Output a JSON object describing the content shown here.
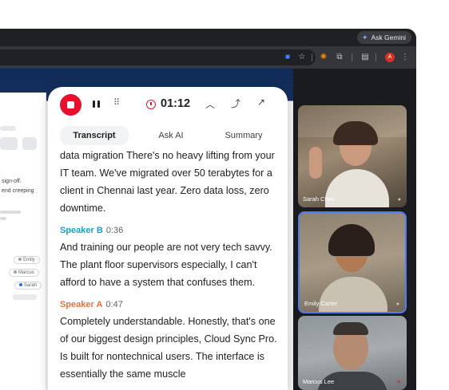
{
  "browser": {
    "gemini_button": "Ask Gemini",
    "profile_initial": "A"
  },
  "document": {
    "lines": [
      "sign-off.",
      "end creeping"
    ],
    "chips": [
      {
        "label": "Emily",
        "color": "#9aa0a6"
      },
      {
        "label": "Marcus",
        "color": "#9aa0a6"
      },
      {
        "label": "Sarah",
        "color": "#1a73e8"
      }
    ]
  },
  "panel": {
    "timer": "01:12",
    "tabs": [
      {
        "label": "Transcript",
        "active": true
      },
      {
        "label": "Ask AI",
        "active": false
      },
      {
        "label": "Summary",
        "active": false
      }
    ],
    "segments": [
      {
        "speaker": "",
        "time": "",
        "text": "data migration There's no heavy lifting from your IT team. We've migrated over 50 terabytes for a client in Chennai last year. Zero data loss, zero downtime."
      },
      {
        "speaker": "Speaker B",
        "time": "0:36",
        "text": "And training our people are not very tech savvy. The plant floor supervisors especially, I can't afford to have a system that confuses them."
      },
      {
        "speaker": "Speaker A",
        "time": "0:47",
        "text": "Completely understandable. Honestly, that's one of our biggest design principles, Cloud Sync Pro. Is built for nontechnical users. The interface is essentially the same muscle"
      }
    ]
  },
  "participants": [
    {
      "name": "Sarah Chen",
      "speaking": false
    },
    {
      "name": "Emily Carter",
      "speaking": true
    },
    {
      "name": "Marcus Lee",
      "speaking": false
    }
  ],
  "colors": {
    "record": "#e8112d",
    "speaker_b": "#12a4c7",
    "speaker_a": "#e07540",
    "active_tile_border": "#4c7cf0"
  }
}
